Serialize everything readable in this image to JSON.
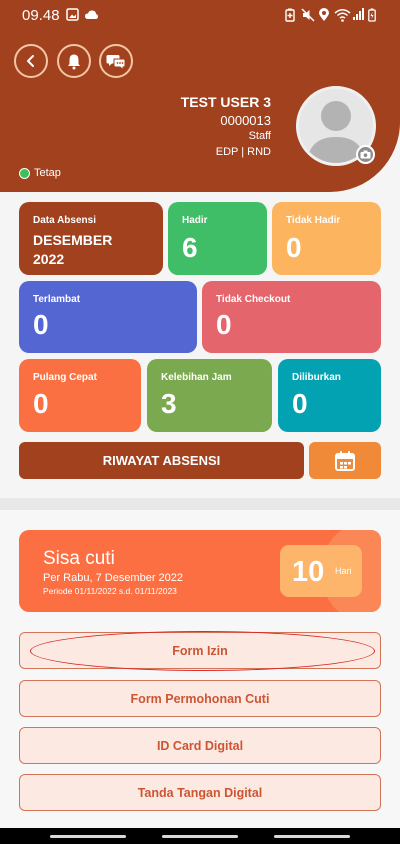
{
  "status_bar": {
    "time": "09.48"
  },
  "header": {
    "user_name": "TEST USER 3",
    "user_id": "0000013",
    "role": "Staff",
    "department": "EDP | RND",
    "employment_status": "Tetap",
    "back_icon": "back-arrow-icon",
    "bell_icon": "bell-icon",
    "chat_icon": "chat-icon"
  },
  "cards": {
    "data_absensi": {
      "label": "Data Absensi",
      "month": "DESEMBER",
      "year": "2022"
    },
    "hadir": {
      "label": "Hadir",
      "value": "6"
    },
    "tidak_hadir": {
      "label": "Tidak Hadir",
      "value": "0"
    },
    "terlambat": {
      "label": "Terlambat",
      "value": "0"
    },
    "tidak_checkout": {
      "label": "Tidak Checkout",
      "value": "0"
    },
    "pulang_cepat": {
      "label": "Pulang Cepat",
      "value": "0"
    },
    "kelebihan_jam": {
      "label": "Kelebihan Jam",
      "value": "3"
    },
    "diliburkan": {
      "label": "Diliburkan",
      "value": "0"
    }
  },
  "riwayat_button": "RIWAYAT ABSENSI",
  "sisa_cuti": {
    "title": "Sisa cuti",
    "date": "Per Rabu, 7 Desember 2022",
    "period": "Periode 01/11/2022  s.d. 01/11/2023",
    "value": "10",
    "unit": "Hari"
  },
  "menu": [
    {
      "label": "Form Izin"
    },
    {
      "label": "Form Permohonan Cuti"
    },
    {
      "label": "ID Card Digital"
    },
    {
      "label": "Tanda Tangan Digital"
    }
  ],
  "colors": {
    "brand": "#a2411e",
    "hadir": "#3fbd67",
    "tidak_hadir": "#fdb45f",
    "terlambat": "#5466d2",
    "tidak_checkout": "#e4656b",
    "pulang_cepat": "#fa7042",
    "kelebihan_jam": "#7ba94f",
    "diliburkan": "#03a2b3"
  }
}
